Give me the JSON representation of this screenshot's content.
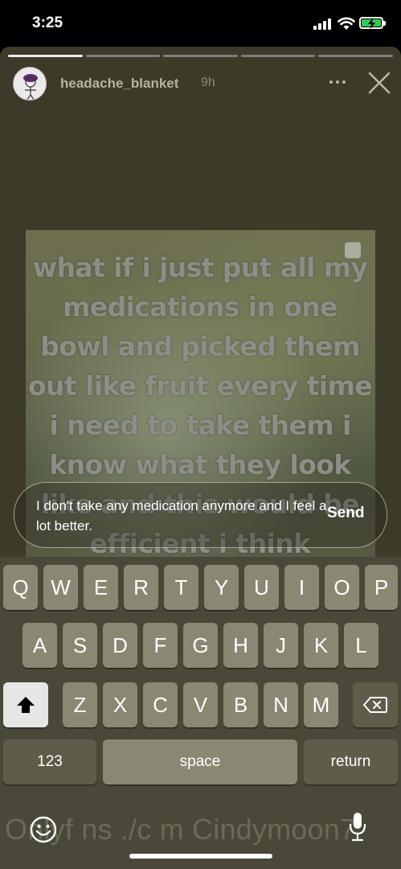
{
  "status_bar": {
    "time": "3:25"
  },
  "story": {
    "username": "headache_blanket",
    "time_ago": "9h",
    "progress": {
      "segments": 5,
      "active_index": 0
    },
    "overlay_text_lines": [
      "what if i just put all my",
      "medications in one",
      "bowl and picked them",
      "out like fruit every time",
      "i need to take them i",
      "know what they look",
      "like and this would be",
      "efficient i think"
    ]
  },
  "reply": {
    "text": "I don't take any medication anymore and I feel a lot better.",
    "send_label": "Send"
  },
  "keyboard": {
    "row1": [
      "Q",
      "W",
      "E",
      "R",
      "T",
      "Y",
      "U",
      "I",
      "O",
      "P"
    ],
    "row2": [
      "A",
      "S",
      "D",
      "F",
      "G",
      "H",
      "J",
      "K",
      "L"
    ],
    "row3": [
      "Z",
      "X",
      "C",
      "V",
      "B",
      "N",
      "M"
    ],
    "numbers_label": "123",
    "space_label": "space",
    "return_label": "return"
  },
  "watermark": "Onlyf ns ./c m Cindymoon7",
  "icons": {
    "signal": "signal-icon",
    "wifi": "wifi-icon",
    "battery": "battery-charging-icon",
    "more": "more-icon",
    "close": "close-icon",
    "shift": "shift-icon",
    "delete": "delete-icon",
    "emoji": "emoji-icon",
    "mic": "mic-icon"
  },
  "colors": {
    "battery_fill": "#34c759",
    "story_bg": "#3d3a2a",
    "key": "#8a8873"
  }
}
